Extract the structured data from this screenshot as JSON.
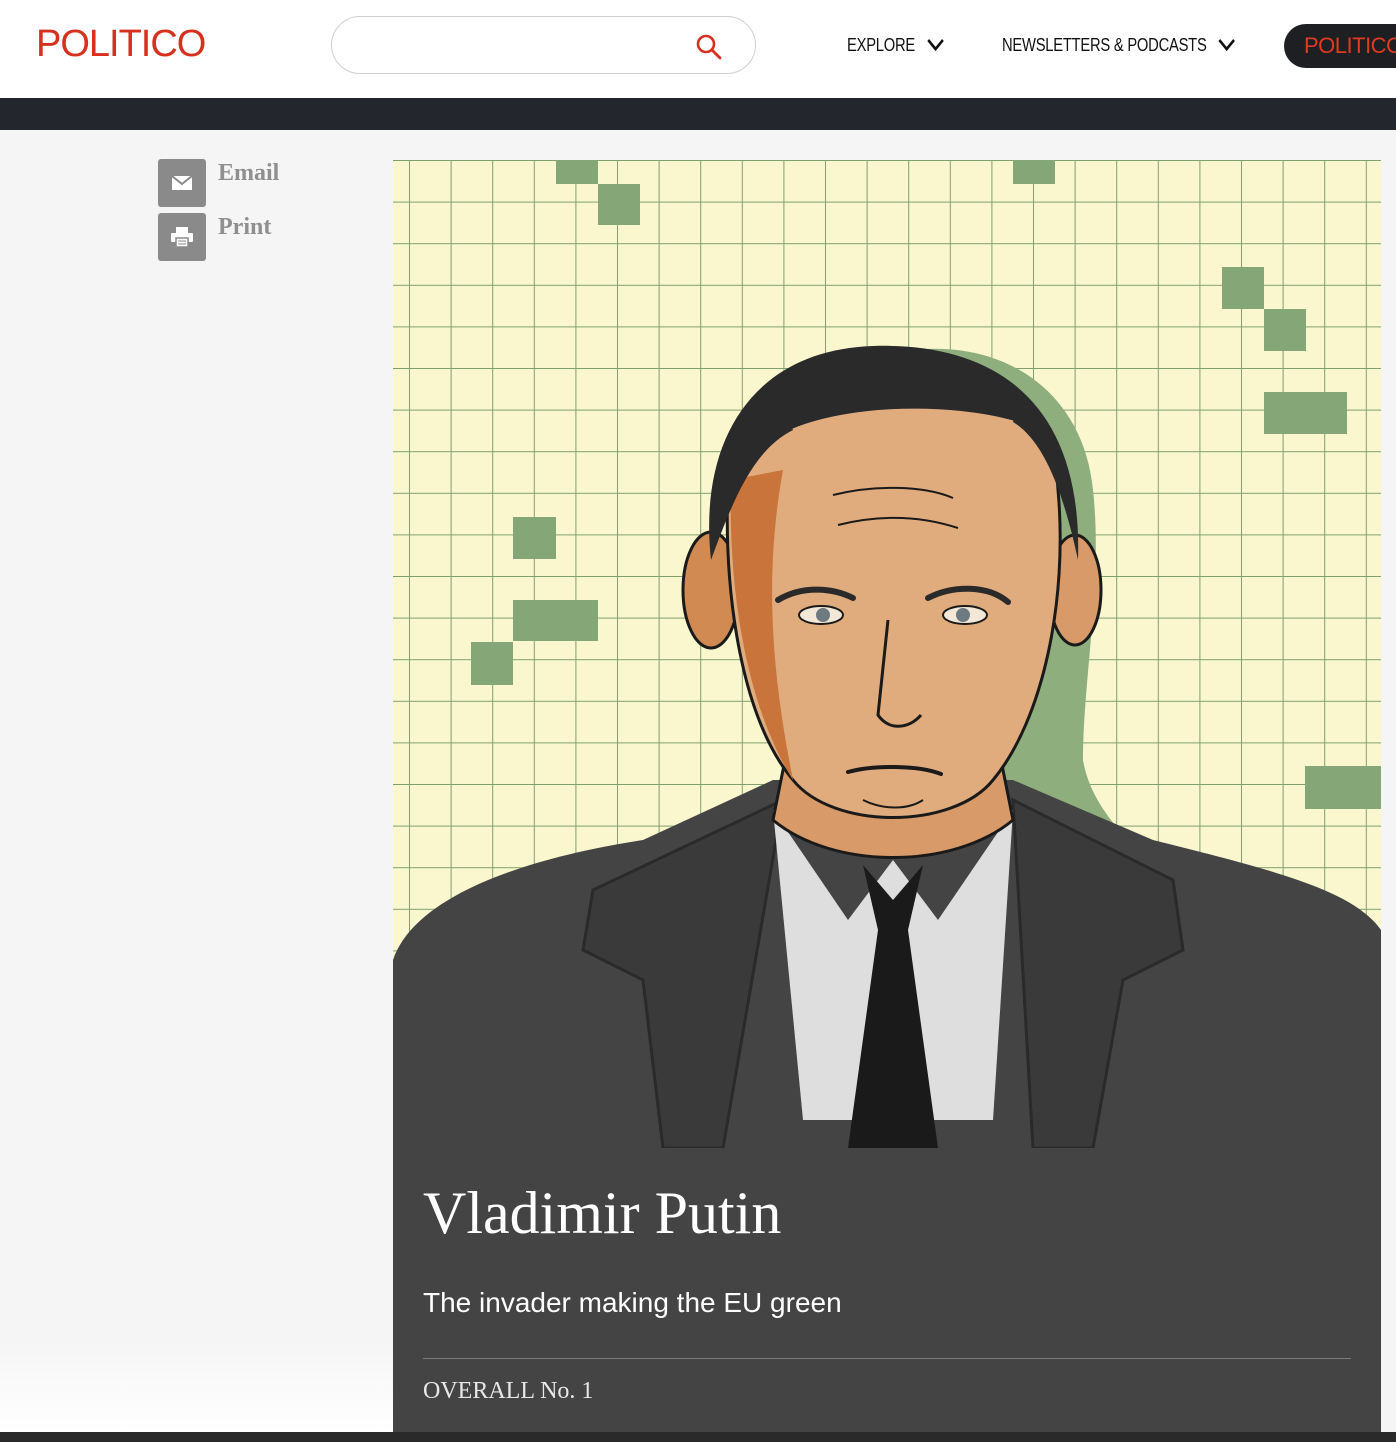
{
  "header": {
    "logo": "POLITICO",
    "search": {
      "value": "",
      "placeholder": ""
    },
    "nav": [
      {
        "label": "EXPLORE"
      },
      {
        "label": "NEWSLETTERS & PODCASTS"
      }
    ],
    "pro_button": "POLITICO"
  },
  "share": {
    "email_label": "Email",
    "print_label": "Print"
  },
  "feature": {
    "image_icon": "portrait-illustration",
    "name": "Vladimir Putin",
    "subtitle": "The invader making the EU green",
    "rank": "OVERALL No. 1"
  },
  "colors": {
    "brand_red": "#d8301e",
    "dark_bar": "#23262c",
    "caption_bg": "#444444",
    "grid_bg": "#faf7cf",
    "grid_green": "#85a676"
  }
}
